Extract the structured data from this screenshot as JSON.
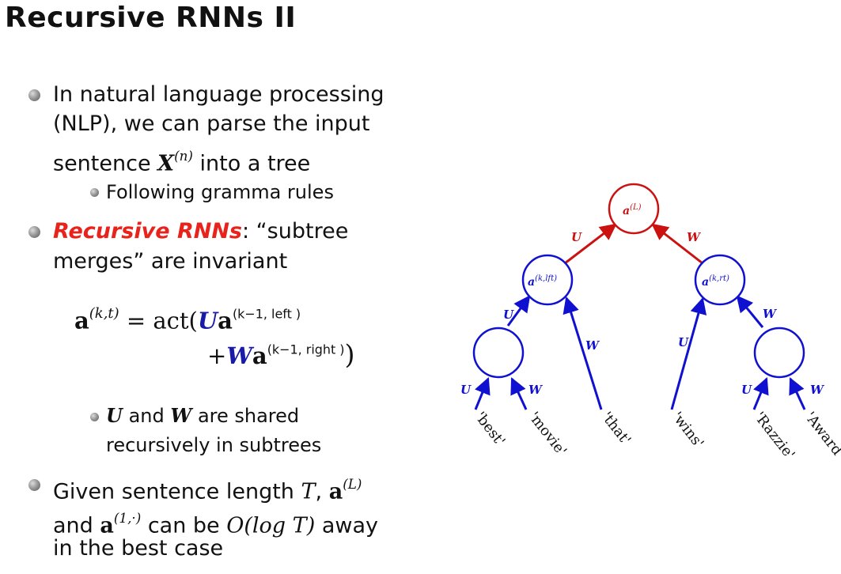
{
  "title": "Recursive RNNs II",
  "bullets": {
    "b1": {
      "line1": "In natural language processing",
      "line2": "(NLP), we can parse the input",
      "line3_pre": "sentence ",
      "line3_sym": "X",
      "line3_sup": "(n)",
      "line3_post": " into a tree"
    },
    "b1_sub": "Following gramma rules",
    "b2": {
      "em": "Recursive RNNs",
      "rest1": ": “subtree",
      "line2": "merges” are invariant"
    },
    "equation": {
      "lhs_a": "a",
      "lhs_sup": "(k,t)",
      "eq": " = act(",
      "U": "U",
      "a1": "a",
      "a1_sup": "(k−1, left )",
      "plus": "+",
      "W": "W",
      "a2": "a",
      "a2_sup": "(k−1, right )",
      "close": ")"
    },
    "b2_sub": {
      "U": "U",
      "and": " and ",
      "W": "W",
      "rest": " are shared",
      "line2": "recursively in subtrees"
    },
    "b3": {
      "pre": "Given sentence length ",
      "T": "T",
      "comma": ", ",
      "a": "a",
      "a_sup": "(L)",
      "line2_and": "and ",
      "a2": "a",
      "a2_sup": "(1,·)",
      "line2_mid": " can be ",
      "O": "O(log",
      "T2": "T",
      "Oclose": ")",
      "line2_post": " away",
      "line3": "in the best case"
    }
  },
  "tree": {
    "colors": {
      "red": "#cc1111",
      "blue": "#1010d0"
    },
    "nodes": {
      "root": {
        "base": "a",
        "sup": "(L)"
      },
      "left": {
        "base": "a",
        "sup": "(k,lft)"
      },
      "right": {
        "base": "a",
        "sup": "(k,rt)"
      }
    },
    "edge_labels": {
      "U": "U",
      "W": "W"
    },
    "words": [
      "'best'",
      "'movie'",
      "'that'",
      "'wins'",
      "'Razzie'",
      "'Award'"
    ]
  }
}
